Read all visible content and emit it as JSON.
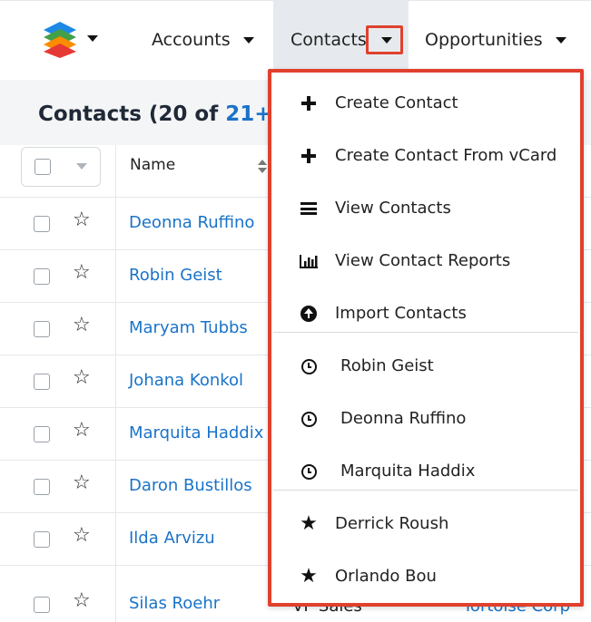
{
  "nav": {
    "accounts_label": "Accounts",
    "contacts_label": "Contacts",
    "opportunities_label": "Opportunities"
  },
  "list": {
    "title_prefix": "Contacts (20 of ",
    "title_count": "21+",
    "title_suffix": ")"
  },
  "table": {
    "name_header": "Name",
    "rows": [
      {
        "name": "Deonna Ruffino",
        "title": "",
        "account": ""
      },
      {
        "name": "Robin Geist",
        "title": "",
        "account": ""
      },
      {
        "name": "Maryam Tubbs",
        "title": "",
        "account": ""
      },
      {
        "name": "Johana Konkol",
        "title": "",
        "account": ""
      },
      {
        "name": "Marquita Haddix",
        "title": "",
        "account": ""
      },
      {
        "name": "Daron Bustillos",
        "title": "",
        "account": ""
      },
      {
        "name": "Ilda Arvizu",
        "title": "",
        "account": ""
      },
      {
        "name": "Silas Roehr",
        "title": "VP Sales",
        "account": "Tortoise Corp"
      }
    ]
  },
  "menu": {
    "items": [
      {
        "label": "Create Contact",
        "icon": "plus-icon"
      },
      {
        "label": "Create Contact From vCard",
        "icon": "plus-icon"
      },
      {
        "label": "View Contacts",
        "icon": "list-icon"
      },
      {
        "label": "View Contact Reports",
        "icon": "bar-chart-icon"
      },
      {
        "label": "Import Contacts",
        "icon": "upload-icon"
      },
      {
        "label": "Robin Geist",
        "icon": "clock-icon"
      },
      {
        "label": "Deonna Ruffino",
        "icon": "clock-icon"
      },
      {
        "label": "Marquita Haddix",
        "icon": "clock-icon"
      },
      {
        "label": "Derrick Roush",
        "icon": "star-icon"
      },
      {
        "label": "Orlando Bou",
        "icon": "star-icon"
      }
    ]
  },
  "colors": {
    "link": "#1a73c9",
    "highlight": "#e0402d",
    "active_nav": "#e6eaee"
  }
}
